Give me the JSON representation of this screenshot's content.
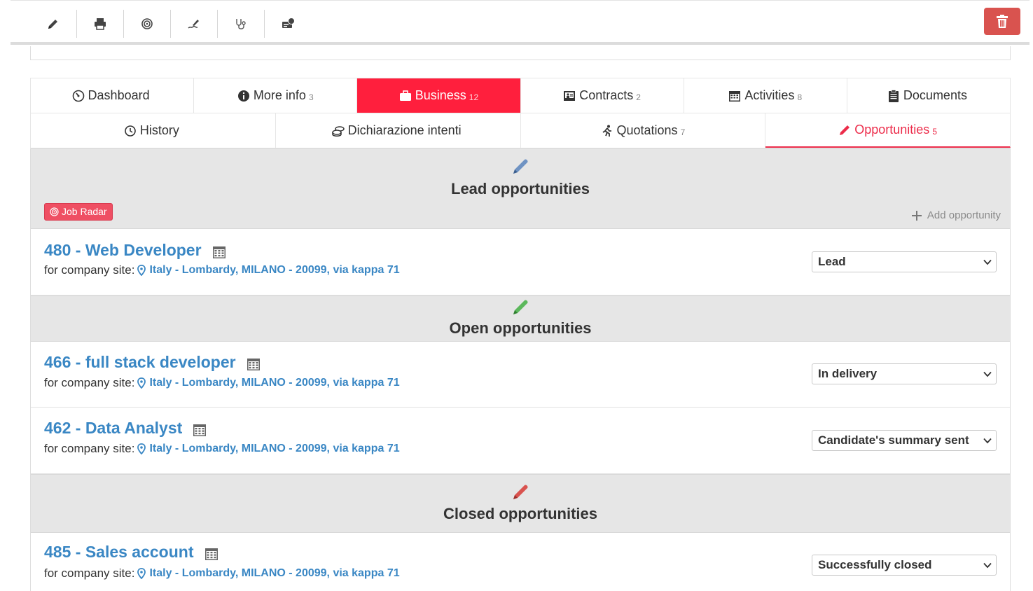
{
  "toolbar": {
    "tools": [
      {
        "icon": "pencil-icon"
      },
      {
        "icon": "printer-icon"
      },
      {
        "icon": "target-icon"
      },
      {
        "icon": "signature-icon"
      },
      {
        "icon": "stethoscope-icon"
      },
      {
        "icon": "money-transfer-icon"
      }
    ],
    "delete_icon": "trash-icon"
  },
  "tabs_row1": [
    {
      "label": "Dashboard",
      "count": "",
      "icon": "gauge-icon"
    },
    {
      "label": "More info",
      "count": "3",
      "icon": "info-icon"
    },
    {
      "label": "Business",
      "count": "12",
      "icon": "briefcase-icon"
    },
    {
      "label": "Contracts",
      "count": "2",
      "icon": "contract-icon"
    },
    {
      "label": "Activities",
      "count": "8",
      "icon": "calendar-icon"
    },
    {
      "label": "Documents",
      "count": "",
      "icon": "clipboard-icon"
    }
  ],
  "tabs_row2": [
    {
      "label": "History",
      "count": "",
      "icon": "history-icon"
    },
    {
      "label": "Dichiarazione intenti",
      "count": "",
      "icon": "coins-icon"
    },
    {
      "label": "Quotations",
      "count": "7",
      "icon": "runner-icon"
    },
    {
      "label": "Opportunities",
      "count": "5",
      "icon": "pen-icon"
    }
  ],
  "sections": {
    "lead": {
      "title": "Lead opportunities",
      "badge": "Job Radar",
      "add_label": "Add opportunity",
      "pen_color": "#6f93c3"
    },
    "open": {
      "title": "Open opportunities",
      "pen_color": "#5cb85c"
    },
    "closed": {
      "title": "Closed opportunities",
      "pen_color": "#d9534f"
    }
  },
  "site_prefix": "for company site:",
  "opportunities": [
    {
      "title": "480 - Web Developer",
      "site": "Italy - Lombardy, MILANO - 20099, via kappa 71",
      "status": "Lead"
    },
    {
      "title": "466 - full stack developer",
      "site": "Italy - Lombardy, MILANO - 20099, via kappa 71",
      "status": "In delivery"
    },
    {
      "title": "462 - Data Analyst",
      "site": "Italy - Lombardy, MILANO - 20099, via kappa 71",
      "status": "Candidate's summary sent"
    },
    {
      "title": "485 - Sales account",
      "site": "Italy - Lombardy, MILANO - 20099, via kappa 71",
      "status": "Successfully closed"
    }
  ],
  "colors": {
    "accent_red": "#ff1f3d",
    "link_blue": "#3a87c4",
    "delete_red": "#d9534f"
  }
}
